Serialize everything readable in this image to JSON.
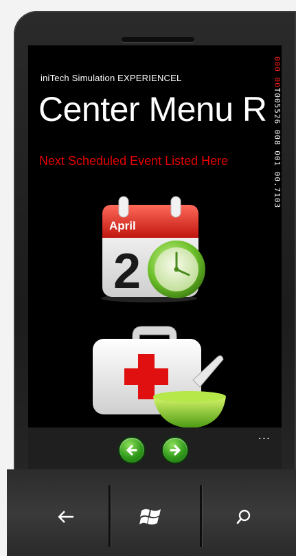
{
  "app": {
    "title": "iniTech Simulation EXPERIENCEL",
    "page_title": "Center Menu R",
    "next_event": "Next Scheduled Event Listed Here"
  },
  "counter": {
    "red_part": "000 00",
    "white_part": "T005526 008 001 00.7103"
  },
  "tiles": {
    "calendar": {
      "label": "April",
      "day": "2"
    }
  },
  "appbar": {
    "more": "..."
  },
  "colors": {
    "event_text": "#e60000",
    "screen_bg": "#000000",
    "nav_button": "#3aa31f"
  },
  "icons": {
    "back_nav": "left-arrow-icon",
    "forward_nav": "right-arrow-icon",
    "hw_back": "back-arrow-icon",
    "hw_start": "windows-logo-icon",
    "hw_search": "search-icon"
  }
}
